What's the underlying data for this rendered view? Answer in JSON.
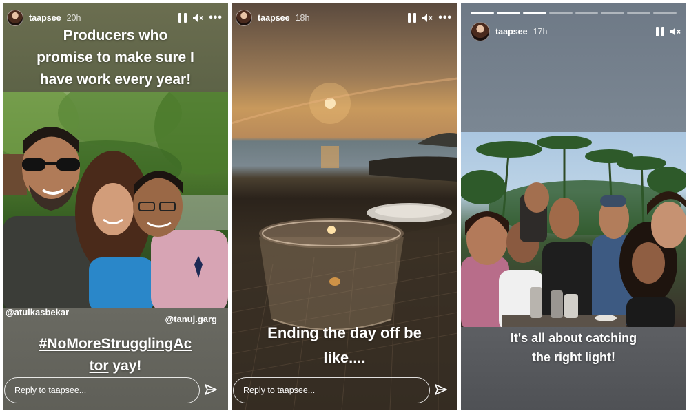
{
  "stories": [
    {
      "username": "taapsee",
      "time": "20h",
      "caption_lines": [
        "Producers who",
        "promise to make sure I",
        "have work every year!"
      ],
      "mention_left": "@atulkasbekar",
      "mention_right": "@tanuj.garg",
      "hashtag_line1": "#NoMoreStrugglingAc",
      "hashtag_line2_link": "tor",
      "hashtag_line2_text": " yay!",
      "reply_placeholder": "Reply to taapsee..."
    },
    {
      "username": "taapsee",
      "time": "18h",
      "caption_lines": [
        "Ending the day off be",
        "like...."
      ],
      "reply_placeholder": "Reply to taapsee..."
    },
    {
      "username": "taapsee",
      "time": "17h",
      "caption_lines": [
        "It's all about catching",
        "the right light!"
      ],
      "progress_segments": 8,
      "progress_done": 3
    }
  ],
  "icons": {
    "pause": "pause-icon",
    "mute": "speaker-muted-icon",
    "more": "more-icon",
    "send": "send-icon"
  }
}
